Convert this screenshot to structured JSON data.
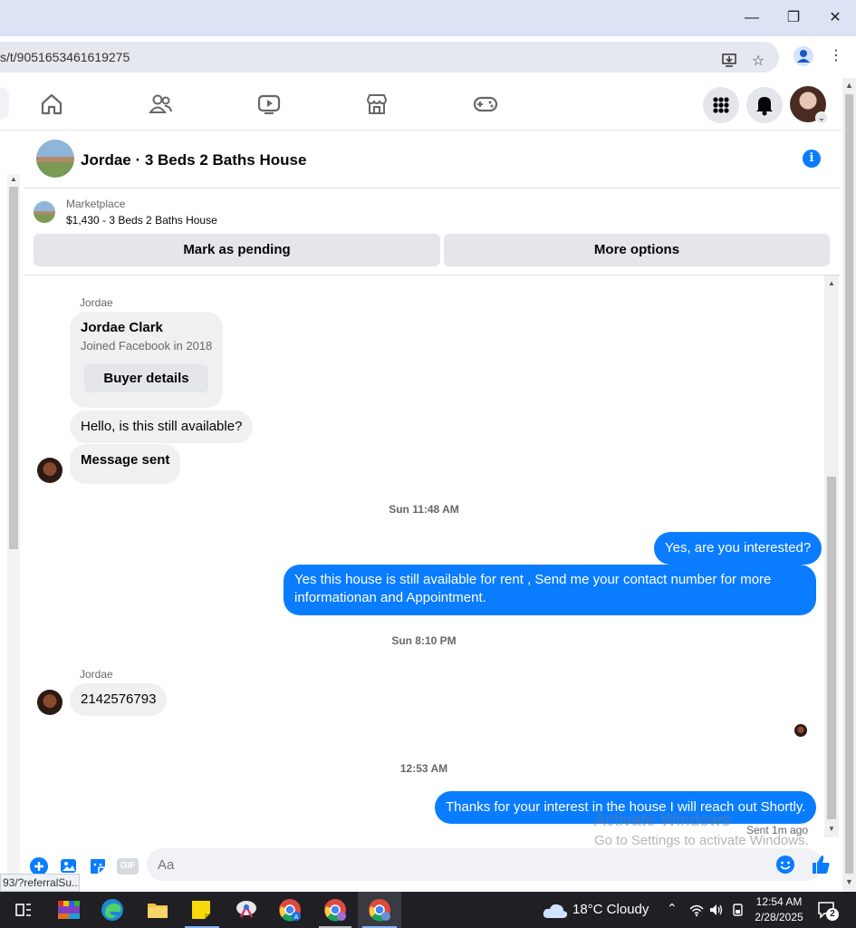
{
  "browser": {
    "url": "s/t/9051653461619275",
    "status_url": "93/?referralSu..."
  },
  "nav": {
    "icons": [
      "home-icon",
      "friends-icon",
      "video-icon",
      "marketplace-icon",
      "gaming-icon"
    ],
    "right_icons": [
      "menu-grid-icon",
      "notifications-icon",
      "profile-avatar"
    ]
  },
  "chat": {
    "title": "Jordae · 3 Beds 2 Baths House",
    "info_icon": "i"
  },
  "marketplace": {
    "label": "Marketplace",
    "listing": "$1,430 - 3 Beds 2 Baths House",
    "mark_pending": "Mark as pending",
    "more_options": "More options"
  },
  "messages": {
    "sender1": "Jordae",
    "card_name": "Jordae Clark",
    "card_joined": "Joined Facebook in 2018",
    "card_button": "Buyer details",
    "msg1": "Hello, is this still available?",
    "msg2": "Message sent",
    "ts1": "Sun 11:48 AM",
    "out1": "Yes, are you interested?",
    "out2": "Yes this house is still available for rent , Send me your contact number for more informationan and Appointment.",
    "ts2": "Sun 8:10 PM",
    "sender2": "Jordae",
    "msg3": "2142576793",
    "ts3": "12:53 AM",
    "out3": "Thanks for your interest in the house I will reach out Shortly.",
    "sent_status": "Sent 1m ago"
  },
  "composer": {
    "placeholder": "Aa",
    "gif_label": "GIF"
  },
  "watermark": {
    "line1": "Activate Windows",
    "line2": "Go to Settings to activate Windows."
  },
  "taskbar": {
    "weather": "18°C  Cloudy",
    "time": "12:54 AM",
    "date": "2/28/2025",
    "notif_count": "2"
  },
  "colors": {
    "accent": "#0a7cff",
    "bubble_in": "#f0f0f0",
    "titlebar": "#dbe3f5"
  }
}
